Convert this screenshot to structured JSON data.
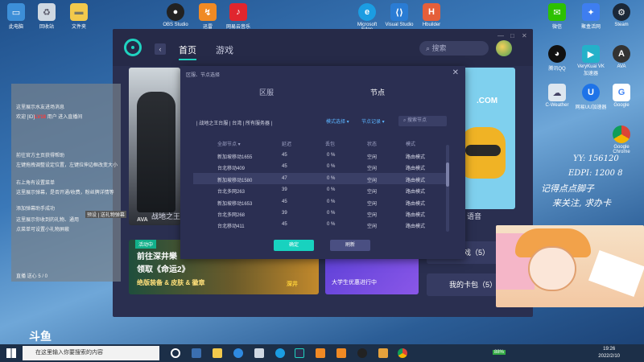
{
  "desktop": {
    "left_icons": [
      "此电脑",
      "回收站",
      "文件夹"
    ],
    "top_icons": [
      "OBS Studio",
      "迅雷",
      "网易云音乐",
      "Microsoft Edge",
      "Visual Studio",
      "Hbuilder"
    ],
    "right_icons": [
      "微信",
      "聚盒活网",
      "Steam",
      "腾讯QQ",
      "VeryKuai VK 加速器",
      "AVA",
      "C-Weather",
      "网易UU加速器",
      "Google",
      "Google Chrome"
    ]
  },
  "app": {
    "nav": {
      "home": "首页",
      "games": "游戏"
    },
    "search_placeholder": "搜索",
    "back": "‹",
    "win_controls": [
      "—",
      "□",
      "✕"
    ],
    "games": [
      {
        "caption": "战地之王",
        "art_text": "AVA"
      },
      {
        "caption": "语音",
        "art_text": ".COM"
      }
    ],
    "banner": {
      "tag": "活动中",
      "line1": "前往深井樂",
      "line2": "领取《命运2》",
      "line3": "绝版装备 & 皮肤 & 徽章",
      "brand": "深井"
    },
    "banner2": "大学生优惠进行中",
    "side_buttons": [
      "的游戏（5）",
      "我的卡包（5）"
    ]
  },
  "modal": {
    "title": "区服、节点选择",
    "close": "✕",
    "tabs": [
      "区服",
      "节点"
    ],
    "breadcrumb": "| 战地之王台服 | 台湾 | 所有服务器 |",
    "filter_mode": "模式选择 ▾",
    "filter_record": "节点记录 ▾",
    "search_placeholder": "搜索节点",
    "headers": [
      "全部节点 ▾",
      "延迟",
      "丢包",
      "状态",
      "模式"
    ],
    "rows": [
      {
        "name": "新加坡移动1655",
        "ping": "45",
        "loss": "0 %",
        "status": "空闲",
        "mode": "路由模式"
      },
      {
        "name": "台北移动409",
        "ping": "45",
        "loss": "0 %",
        "status": "空闲",
        "mode": "路由模式"
      },
      {
        "name": "新加坡移动1580",
        "ping": "47",
        "loss": "0 %",
        "status": "空闲",
        "mode": "路由模式"
      },
      {
        "name": "台北多网263",
        "ping": "39",
        "loss": "0 %",
        "status": "空闲",
        "mode": "路由模式"
      },
      {
        "name": "新加坡移动1653",
        "ping": "45",
        "loss": "0 %",
        "status": "空闲",
        "mode": "路由模式"
      },
      {
        "name": "台北多网268",
        "ping": "39",
        "loss": "0 %",
        "status": "空闲",
        "mode": "路由模式"
      },
      {
        "name": "台北移动411",
        "ping": "45",
        "loss": "0 %",
        "status": "空闲",
        "mode": "路由模式"
      }
    ],
    "ok": "确定",
    "cancel": "刷新"
  },
  "chat": {
    "lines": [
      "这里展示水友进场消息",
      "欢迎 [ID]LV18 用户 进入直播间",
      "",
      "前往官方主页获得帮助",
      "左键拖拽调整设定位置，左键拉伸边框改变大小",
      "右上角有设置菜单",
      "这里展示弹幕，是否开通/收费，粉丝牌详情等",
      "添加弹幕助手成功",
      "这里展示你收到的礼物、通用",
      "点菜单可设置小礼物屏蔽"
    ],
    "highlight": "LV18",
    "footer": "预设 | 送礼物弹幕",
    "watermark": "直播 送心 5 / 0"
  },
  "overlay_text": {
    "yy": "YY: 156120",
    "edpi": "EDPI: 1200 8",
    "line1": "记得点点脚子",
    "line2": "来关注, 求办卡"
  },
  "taskbar": {
    "search_placeholder": "在这里输入你要搜索的内容",
    "time": "19:26",
    "date": "2022/2/10",
    "battery": "88%",
    "stream_logo": "斗鱼"
  }
}
